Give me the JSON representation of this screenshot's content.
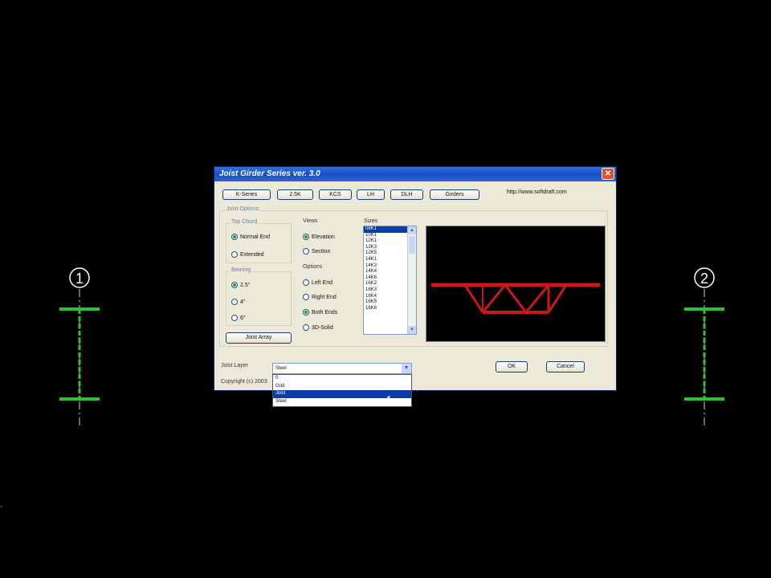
{
  "dialog": {
    "title": "Joist Girder Series ver. 3.0",
    "close_label": "✕",
    "url": "http://www.softdraft.com",
    "series_buttons": [
      "K-Series",
      "2.5K",
      "KCS",
      "LH",
      "DLH",
      "Girders"
    ],
    "joist_options_label": "Joist Options",
    "top_chord": {
      "label": "Top Chord",
      "options": [
        "Normal End",
        "Extended"
      ],
      "selected": "Normal End"
    },
    "bearing": {
      "label": "Bearing",
      "options": [
        "2.5\"",
        "4\"",
        "6\""
      ],
      "selected": "2.5\""
    },
    "joist_array_button": "Joist Array",
    "views": {
      "label": "Views",
      "options": [
        "Elevation",
        "Section"
      ],
      "selected": "Elevation"
    },
    "options": {
      "label": "Options",
      "items": [
        "Left End",
        "Right End",
        "Both Ends",
        "3D-Solid"
      ],
      "selected": "Both Ends"
    },
    "sizes": {
      "label": "Sizes",
      "items": [
        "08K1",
        "10K1",
        "12K1",
        "12K3",
        "12K5",
        "14K1",
        "14K3",
        "14K4",
        "14K6",
        "16K2",
        "16K3",
        "16K4",
        "16K5",
        "16K6"
      ],
      "selected": "08K1"
    },
    "joist_layer": {
      "label": "Joist Layer",
      "value": "Steel",
      "dropdown_items": [
        "0",
        "Grid",
        "Joist",
        "Steel"
      ],
      "highlighted": "Joist"
    },
    "copyright": "Copyright (c) 2003",
    "ok_label": "OK",
    "cancel_label": "Cancel"
  },
  "cad": {
    "grid_marks": [
      "1",
      "2"
    ],
    "line_color": "#2fbf3a",
    "truss_color": "#c81818"
  }
}
